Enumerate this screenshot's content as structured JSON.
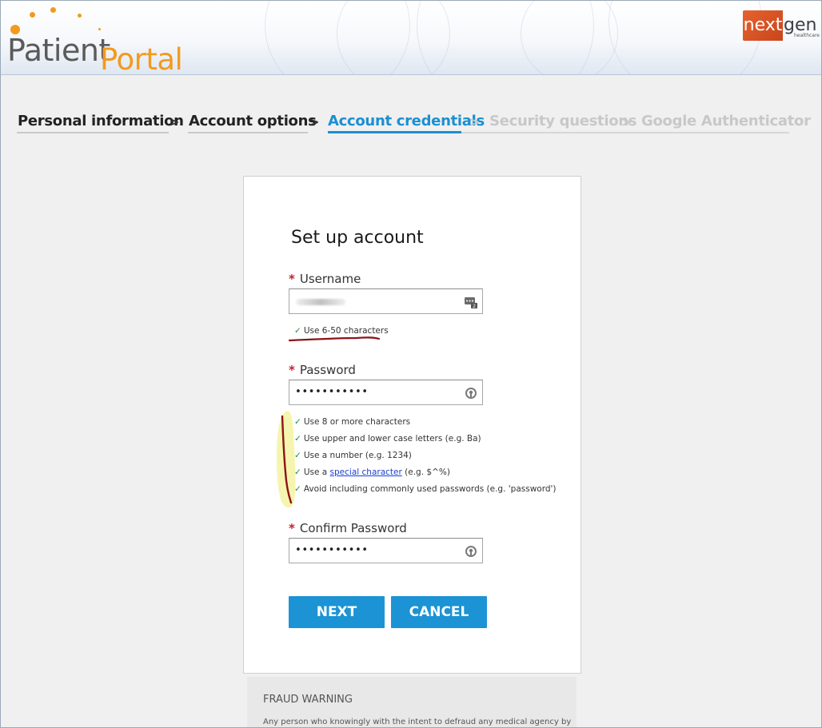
{
  "header": {
    "logo": {
      "word1": "Patient",
      "word2": "Portal"
    },
    "brand": {
      "part1": "next",
      "part2": "gen",
      "sub": "healthcare"
    }
  },
  "breadcrumb": {
    "steps": [
      {
        "label": "Personal information",
        "state": "done"
      },
      {
        "label": "Account options",
        "state": "done"
      },
      {
        "label": "Account credentials",
        "state": "active"
      },
      {
        "label": "Security questions",
        "state": "todo"
      },
      {
        "label": "Google Authenticator",
        "state": "todo"
      }
    ],
    "separator": ">"
  },
  "form": {
    "title": "Set up account",
    "required_marker": "*",
    "username": {
      "label": "Username",
      "rule": "Use 6-50 characters"
    },
    "password": {
      "label": "Password",
      "value": "•••••••••••",
      "rules": [
        {
          "text": "Use 8 or more characters"
        },
        {
          "text": "Use upper and lower case letters (e.g. Ba)"
        },
        {
          "text": "Use a number (e.g. 1234)"
        },
        {
          "pre": "Use a ",
          "link": "special character",
          "post": " (e.g. $^%)"
        },
        {
          "text": "Avoid including commonly used passwords (e.g. 'password')"
        }
      ]
    },
    "confirm": {
      "label": "Confirm Password",
      "value": "•••••••••••"
    },
    "check_glyph": "✓",
    "buttons": {
      "next": "NEXT",
      "cancel": "CANCEL"
    }
  },
  "fraud": {
    "heading": "FRAUD WARNING",
    "text": "Any person who knowingly with the intent to defraud any medical agency by"
  },
  "colors": {
    "accent": "#1c8fd1",
    "button": "#1c93d4",
    "check": "#1e8b3a",
    "required": "#c0212b",
    "logo_orange": "#f39a1e",
    "brand_red": "#d4522a"
  }
}
